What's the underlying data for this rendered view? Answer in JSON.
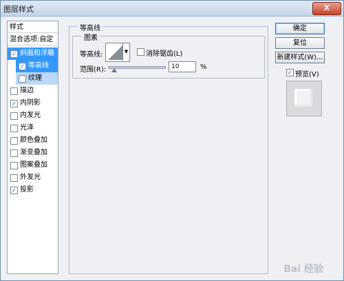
{
  "window": {
    "title": "图层样式",
    "close_glyph": "X"
  },
  "left_panel": {
    "header": "样式",
    "blend_options": "混合选项:自定",
    "items": [
      {
        "label": "斜面和浮雕",
        "checked": true,
        "state": "selected"
      },
      {
        "label": "等高线",
        "checked": true,
        "state": "sub-selected"
      },
      {
        "label": "纹理",
        "checked": false,
        "state": "sub"
      },
      {
        "label": "描边",
        "checked": false
      },
      {
        "label": "内阴影",
        "checked": true
      },
      {
        "label": "内发光",
        "checked": false
      },
      {
        "label": "光泽",
        "checked": false
      },
      {
        "label": "颜色叠加",
        "checked": false
      },
      {
        "label": "渐变叠加",
        "checked": false
      },
      {
        "label": "图案叠加",
        "checked": false
      },
      {
        "label": "外发光",
        "checked": false
      },
      {
        "label": "投影",
        "checked": true
      }
    ]
  },
  "contour": {
    "group_title": "等高线",
    "sub_title": "图素",
    "contour_label": "等高线:",
    "antialias_label": "消除锯齿(L)",
    "antialias_checked": false,
    "range_label": "范围(R):",
    "range_value": "10",
    "range_unit": "%",
    "range_percent": 10
  },
  "buttons": {
    "ok": "确定",
    "reset": "复位",
    "new_style": "新建样式(W)...",
    "preview_label": "预览(V)",
    "preview_checked": true
  },
  "watermark": "Bai 经验"
}
